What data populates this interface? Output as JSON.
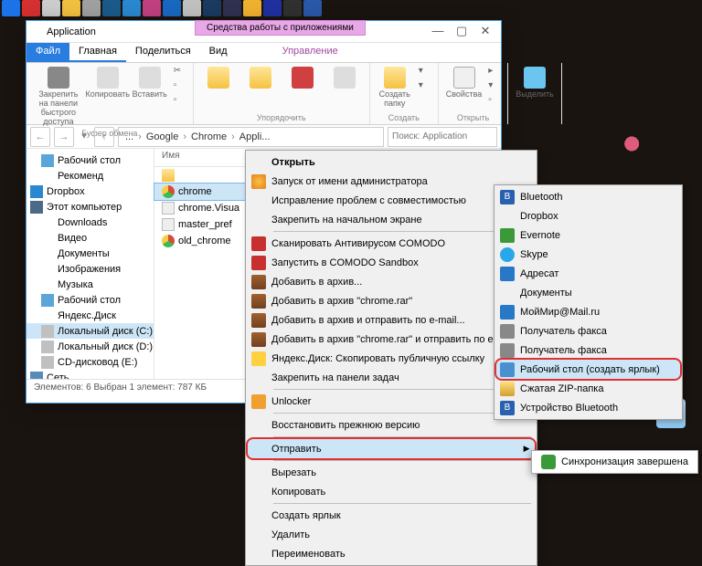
{
  "taskbar_icons": [
    "#1a73e8",
    "#d63030",
    "#ccc",
    "#f0c040",
    "#a0a0a0",
    "#1a5a8a",
    "#2a88d0",
    "#c04080",
    "#1868c0",
    "#c0c0c0",
    "#1a3a60",
    "#303050",
    "#f0b030",
    "#2030a0",
    "#303030",
    "#2a58a8"
  ],
  "window": {
    "title": "Application",
    "ribbon_ext_label": "Средства работы с приложениями",
    "tabs": {
      "file": "Файл",
      "home": "Главная",
      "share": "Поделиться",
      "view": "Вид",
      "manage": "Управление"
    },
    "ribbon": {
      "pin": "Закрепить на панели\nбыстрого доступа",
      "copy": "Копировать",
      "paste": "Вставить",
      "clipboard_label": "Буфер обмена",
      "organize_label": "Упорядочить",
      "newfolder": "Создать\nпапку",
      "create_label": "Создать",
      "properties": "Свойства",
      "open_label": "Открыть",
      "select": "Выделить"
    },
    "breadcrumbs": [
      "...",
      "Google",
      "Chrome",
      "Appli..."
    ],
    "search_placeholder": "Поиск: Application",
    "nav": [
      {
        "label": "Рабочий стол",
        "cls": "desktop"
      },
      {
        "label": "Рекоменд",
        "cls": "folder"
      },
      {
        "label": "Dropbox",
        "cls": "dropbox",
        "bold": true
      },
      {
        "label": "Этот компьютер",
        "cls": "pc",
        "bold": true
      },
      {
        "label": "Downloads",
        "cls": "folder"
      },
      {
        "label": "Видео",
        "cls": "folder"
      },
      {
        "label": "Документы",
        "cls": "folder"
      },
      {
        "label": "Изображения",
        "cls": "folder"
      },
      {
        "label": "Музыка",
        "cls": "folder"
      },
      {
        "label": "Рабочий стол",
        "cls": "desktop"
      },
      {
        "label": "Яндекс.Диск",
        "cls": "folder"
      },
      {
        "label": "Локальный диск (C:)",
        "cls": "drive",
        "sel": true
      },
      {
        "label": "Локальный диск (D:)",
        "cls": "drive"
      },
      {
        "label": "CD-дисковод (E:)",
        "cls": "drive"
      },
      {
        "label": "Сеть",
        "cls": "net",
        "bold": true
      }
    ],
    "col_header": "Имя",
    "files": [
      {
        "name": "",
        "cls": "folder"
      },
      {
        "name": "chrome",
        "cls": "chrome",
        "sel": true
      },
      {
        "name": "chrome.Visua",
        "cls": "file"
      },
      {
        "name": "master_pref",
        "cls": "file"
      },
      {
        "name": "old_chrome",
        "cls": "chrome"
      }
    ],
    "status": "Элементов: 6   Выбран 1 элемент: 787 КБ"
  },
  "context_menu": [
    {
      "label": "Открыть",
      "bold": true
    },
    {
      "label": "Запуск от имени администратора",
      "ico": "shield"
    },
    {
      "label": "Исправление проблем с совместимостью"
    },
    {
      "label": "Закрепить на начальном экране"
    },
    {
      "sep": true
    },
    {
      "label": "Сканировать Антивирусом COMODO",
      "ico": "comodo"
    },
    {
      "label": "Запустить в COMODO Sandbox",
      "ico": "comodo"
    },
    {
      "label": "Добавить в архив...",
      "ico": "winrar"
    },
    {
      "label": "Добавить в архив \"chrome.rar\"",
      "ico": "winrar"
    },
    {
      "label": "Добавить в архив и отправить по e-mail...",
      "ico": "winrar"
    },
    {
      "label": "Добавить в архив \"chrome.rar\" и отправить по e-mail",
      "ico": "winrar"
    },
    {
      "label": "Яндекс.Диск: Скопировать публичную ссылку",
      "ico": "yadisk"
    },
    {
      "label": "Закрепить на панели задач"
    },
    {
      "sep": true
    },
    {
      "label": "Unlocker",
      "ico": "unlock"
    },
    {
      "sep": true
    },
    {
      "label": "Восстановить прежнюю версию"
    },
    {
      "sep": true
    },
    {
      "label": "Отправить",
      "sub": true,
      "hl": true,
      "redbox": true
    },
    {
      "sep": true
    },
    {
      "label": "Вырезать"
    },
    {
      "label": "Копировать"
    },
    {
      "sep": true
    },
    {
      "label": "Создать ярлык"
    },
    {
      "label": "Удалить"
    },
    {
      "label": "Переименовать"
    }
  ],
  "submenu": [
    {
      "label": "Bluetooth",
      "ico": "bt",
      "txt": "B"
    },
    {
      "label": "Dropbox",
      "ico": "dropbox"
    },
    {
      "label": "Evernote",
      "ico": "ev"
    },
    {
      "label": "Skype",
      "ico": "skype"
    },
    {
      "label": "Адресат",
      "ico": "mail"
    },
    {
      "label": "Документы",
      "ico": "folder"
    },
    {
      "label": "МойМир@Mail.ru",
      "ico": "mail"
    },
    {
      "label": "Получатель факса",
      "ico": "fax"
    },
    {
      "label": "Получатель факса",
      "ico": "fax"
    },
    {
      "label": "Рабочий стол (создать ярлык)",
      "ico": "desk",
      "hl": true,
      "redbox": true
    },
    {
      "label": "Сжатая ZIP-папка",
      "ico": "zip"
    },
    {
      "label": "Устройство Bluetooth",
      "ico": "bt",
      "txt": "B"
    }
  ],
  "notification": {
    "text": "Синхронизация завершена"
  }
}
